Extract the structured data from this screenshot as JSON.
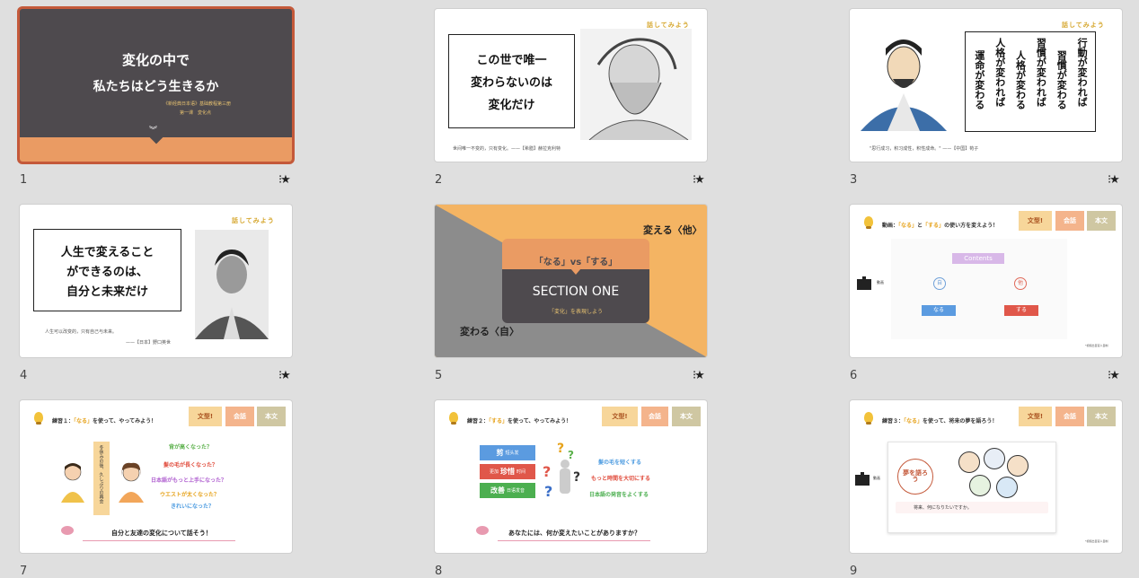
{
  "slides": [
    {
      "num": "1",
      "title_line1": "変化の中で",
      "title_line2": "私たちはどう生きるか",
      "sub1": "《新经典日本语》基础教程第三册",
      "sub2": "第一课　変化点"
    },
    {
      "num": "2",
      "tag": "話してみよう",
      "box": [
        "この世で唯一",
        "変わらないのは",
        "変化だけ"
      ],
      "caption": "世间唯一不变的，只有变化。——【希腊】赫拉克利特"
    },
    {
      "num": "3",
      "tag": "話してみよう",
      "vertical": [
        "行動が変われば",
        "習慣が変わる",
        "習慣が変われば",
        "人格が変わる",
        "人格が変われば",
        "運命が変わる"
      ],
      "caption": "\"思行成习，积习成性，积性成命。\" ——【中国】荀子"
    },
    {
      "num": "4",
      "tag": "話してみよう",
      "box": [
        "人生で変えること",
        "ができるのは、",
        "自分と未来だけ"
      ],
      "caption1": "人生可以改变的，只有自己与未来。",
      "caption2": "——【日本】野口英世"
    },
    {
      "num": "5",
      "top_right": "変える〈他〉",
      "bottom_left": "変わる〈自〉",
      "card_top": "「なる」vs「する」",
      "card_title": "SECTION ONE",
      "card_sub": "「変化」を表現しよう"
    },
    {
      "num": "6",
      "header_pre": "動画：",
      "hl1": "「なる」",
      "mid": "と",
      "hl2": "「する」",
      "header_post": "の使い方を変えよう！",
      "tabs": [
        "文型!",
        "会話",
        "本文"
      ],
      "clap_label": "動画",
      "contents": "Contents",
      "circle1": "自",
      "circle2": "他",
      "btn1": "なる",
      "btn2": "する",
      "note": "*视频出自富人自制"
    },
    {
      "num": "7",
      "header_pre": "練習１：",
      "hl1": "「なる」",
      "header_post": "を使って、やってみよう！",
      "tabs": [
        "文型!",
        "会話",
        "本文"
      ],
      "vertical": "冬休みの後、久しぶりの再会",
      "lines": [
        "背が高くなった？",
        "髪の毛が長くなった？",
        "日本語がもっと上手になった？",
        "ウエストが太くなった？",
        "きれいになった？"
      ],
      "bottom": "自分と友達の変化について話そう！"
    },
    {
      "num": "8",
      "header_pre": "練習２：",
      "hl1": "「する」",
      "header_post": "を使って、やってみよう！",
      "tabs": [
        "文型!",
        "会話",
        "本文"
      ],
      "chips": [
        "剪",
        "短头发",
        "更加",
        "珍惜",
        "时间",
        "改善",
        "日语发音"
      ],
      "lines": [
        "髪の毛を短くする",
        "もっと時間を大切にする",
        "日本語の発音をよくする"
      ],
      "bottom": "あなたには、何か変えたいことがありますか？"
    },
    {
      "num": "9",
      "header_pre": "練習３：",
      "hl1": "「なる」",
      "header_post": "を使って、将来の夢を語ろう！",
      "tabs": [
        "文型!",
        "会話",
        "本文"
      ],
      "clap_label": "動画",
      "dream": "夢を語ろう",
      "speech": "将来、何になりたいですか。",
      "note": "*视频出自富人自制"
    }
  ],
  "colors": {
    "orange": "#ea9b63",
    "dark": "#4e4a4e",
    "red": "#c4593a",
    "yellow": "#f7d69a",
    "gold": "#d6a72e"
  }
}
